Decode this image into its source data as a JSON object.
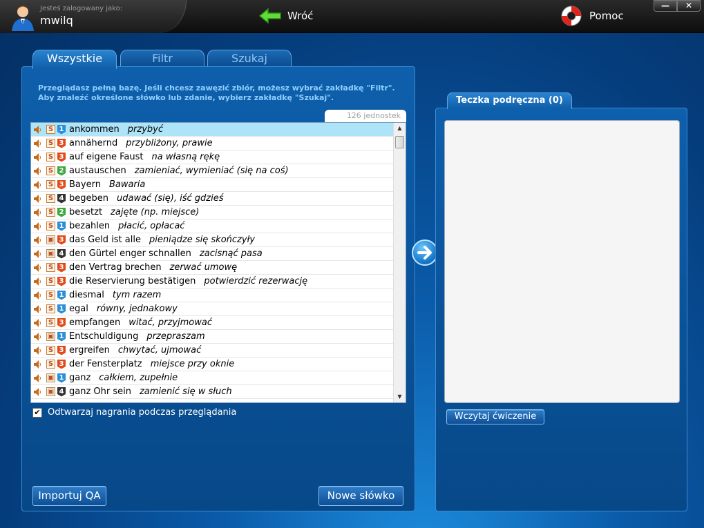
{
  "user": {
    "logged_label": "Jesteś zalogowany jako:",
    "name": "mwilq"
  },
  "nav": {
    "back_label": "Wróć",
    "help_label": "Pomoc"
  },
  "window": {
    "minimize": "—",
    "close": "✕"
  },
  "tabs": [
    {
      "label": "Wszystkie",
      "active": true
    },
    {
      "label": "Filtr",
      "active": false
    },
    {
      "label": "Szukaj",
      "active": false
    }
  ],
  "left_panel": {
    "info": "Przeglądasz pełną bazę. Jeśli chcesz zawęzić zbiór, możesz wybrać zakładkę \"Filtr\". Aby znaleźć określone słówko lub zdanie, wybierz zakładkę \"Szukaj\".",
    "count": "126 jednostek",
    "items": [
      {
        "word": "ankommen",
        "translation": "przybyć",
        "type": "S",
        "level": "1",
        "selected": true
      },
      {
        "word": "annähernd",
        "translation": "przybliżony, prawie",
        "type": "S",
        "level": "3"
      },
      {
        "word": "auf eigene Faust",
        "translation": "na własną rękę",
        "type": "S",
        "level": "3"
      },
      {
        "word": "austauschen",
        "translation": "zamieniać, wymieniać (się na coś)",
        "type": "S",
        "level": "2"
      },
      {
        "word": "Bayern",
        "translation": "Bawaria",
        "type": "S",
        "level": "3"
      },
      {
        "word": "begeben",
        "translation": "udawać (się), iść gdzieś",
        "type": "S",
        "level": "4"
      },
      {
        "word": "besetzt",
        "translation": "zajęte (np. miejsce)",
        "type": "S",
        "level": "2"
      },
      {
        "word": "bezahlen",
        "translation": "płacić, opłacać",
        "type": "S",
        "level": "1"
      },
      {
        "word": "das Geld ist alle",
        "translation": "pieniądze się skończyły",
        "type": "I",
        "level": "3"
      },
      {
        "word": "den Gürtel enger schnallen",
        "translation": "zacisnąć pasa",
        "type": "I",
        "level": "4"
      },
      {
        "word": "den Vertrag brechen",
        "translation": "zerwać umowę",
        "type": "S",
        "level": "3"
      },
      {
        "word": "die Reservierung bestätigen",
        "translation": "potwierdzić rezerwację",
        "type": "S",
        "level": "3"
      },
      {
        "word": "diesmal",
        "translation": "tym razem",
        "type": "S",
        "level": "1"
      },
      {
        "word": "egal",
        "translation": "równy, jednakowy",
        "type": "S",
        "level": "1"
      },
      {
        "word": "empfangen",
        "translation": "witać, przyjmować",
        "type": "S",
        "level": "3"
      },
      {
        "word": "Entschuldigung",
        "translation": "przepraszam",
        "type": "I",
        "level": "1"
      },
      {
        "word": "ergreifen",
        "translation": "chwytać, ujmować",
        "type": "S",
        "level": "3"
      },
      {
        "word": "der Fensterplatz",
        "translation": "miejsce przy oknie",
        "type": "S",
        "level": "3"
      },
      {
        "word": "ganz",
        "translation": "całkiem, zupełnie",
        "type": "I",
        "level": "1"
      },
      {
        "word": "ganz Ohr sein",
        "translation": "zamienić się w słuch",
        "type": "I",
        "level": "4"
      }
    ],
    "checkbox_label": "Odtwarzaj nagrania podczas przeglądania",
    "checkbox_checked": "✔",
    "import_label": "Importuj QA",
    "new_word_label": "Nowe słówko"
  },
  "right_panel": {
    "tab_label": "Teczka podręczna (0)",
    "load_label": "Wczytaj ćwiczenie"
  }
}
